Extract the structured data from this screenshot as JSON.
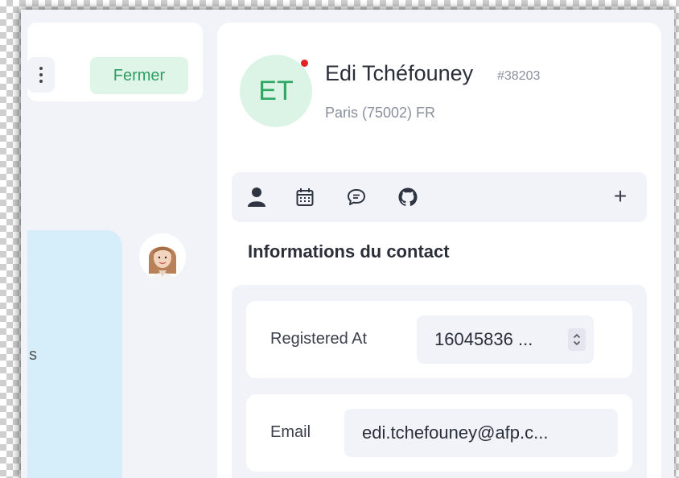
{
  "toolbar": {
    "more_icon": "kebab-vertical-icon",
    "close_label": "Fermer"
  },
  "chat": {
    "bubble_text": "s"
  },
  "contact": {
    "initials": "ET",
    "name": "Edi Tchéfouney",
    "id": "#38203",
    "location": "Paris (75002) FR",
    "status_color": "#e02424"
  },
  "tabs": [
    {
      "icon": "user-icon"
    },
    {
      "icon": "calendar-icon"
    },
    {
      "icon": "chat-bubble-icon"
    },
    {
      "icon": "github-icon"
    }
  ],
  "add_icon": "+",
  "section": {
    "title": "Informations du contact"
  },
  "fields": [
    {
      "label": "Registered At",
      "value": "16045836 ..."
    },
    {
      "label": "Email",
      "value": "edi.tchefouney@afp.c..."
    }
  ],
  "colors": {
    "accent_green": "#2fa863",
    "close_bg": "#dff5e8",
    "chat_bubble": "#d6eef9"
  }
}
